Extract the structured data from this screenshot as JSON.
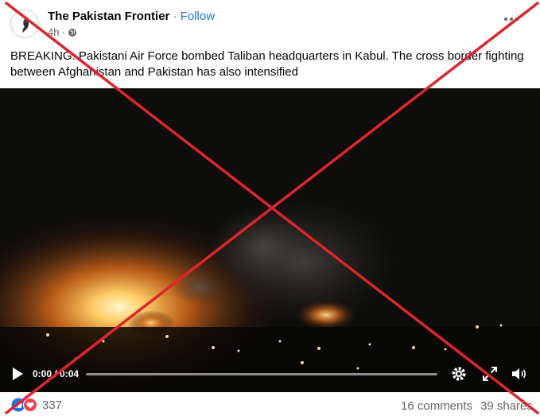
{
  "post": {
    "page_name": "The Pakistan Frontier",
    "separator": "·",
    "follow_label": "Follow",
    "time_ago": "4h",
    "meta_separator": "·",
    "privacy_icon": "globe-icon",
    "text": "BREAKING: Pakistani Air Force bombed Taliban headquarters in Kabul.  The cross border fighting between Afghanistan and Pakistan has also intensified"
  },
  "video": {
    "time_display": "0:00 / 0:04",
    "progress_fraction": 0.0,
    "icons": [
      "play-icon",
      "settings-icon",
      "fullscreen-icon",
      "volume-icon"
    ]
  },
  "footer": {
    "reactions": [
      "like-icon",
      "love-icon"
    ],
    "reaction_count": "337",
    "comments": "16 comments",
    "shares": "39 shares"
  },
  "overlay": {
    "mark": "cross-out",
    "color": "#e0242b"
  }
}
